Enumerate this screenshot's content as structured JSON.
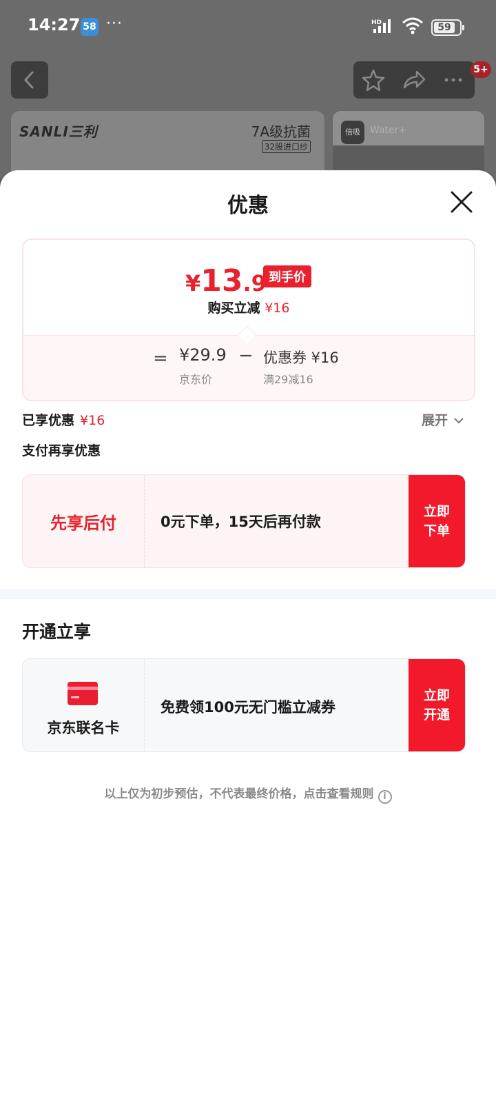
{
  "status_bar": {
    "time": "14:27",
    "app_badge": "58",
    "dots": "···",
    "hd": "HD",
    "battery": "59"
  },
  "top_bar": {
    "notification_badge": "5+"
  },
  "product": {
    "brand": "SANLI三利",
    "title": "7A级抗菌",
    "tag": "32股进口纱"
  },
  "side_card": {
    "logo": "倍吸",
    "text": "Water+"
  },
  "sheet": {
    "title": "优惠",
    "price": {
      "yen": "¥",
      "integer": "13",
      "decimal": ".9",
      "tag": "到手价"
    },
    "reduce_label": "购买立减",
    "reduce_value": "¥16",
    "formula": {
      "equals": "=",
      "jd_price": "¥29.9",
      "jd_label": "京东价",
      "minus": "−",
      "coupon": "优惠券 ¥16",
      "coupon_sub": "满29减16"
    },
    "enjoyed_label": "已享优惠",
    "enjoyed_value": "¥16",
    "expand_label": "展开",
    "pay_more_label": "支付再享优惠",
    "pay_later": {
      "label": "先享后付",
      "desc": "0元下单，15天后再付款",
      "button": "立即下单"
    },
    "open_title": "开通立享",
    "card_offer": {
      "label": "京东联名卡",
      "desc": "免费领100元无门槛立减券",
      "button": "立即开通"
    },
    "disclaimer": "以上仅为初步预估，不代表最终价格，点击查看规则",
    "info_icon": "i"
  },
  "colors": {
    "accent": "#e8212c",
    "button": "#f2192b"
  }
}
